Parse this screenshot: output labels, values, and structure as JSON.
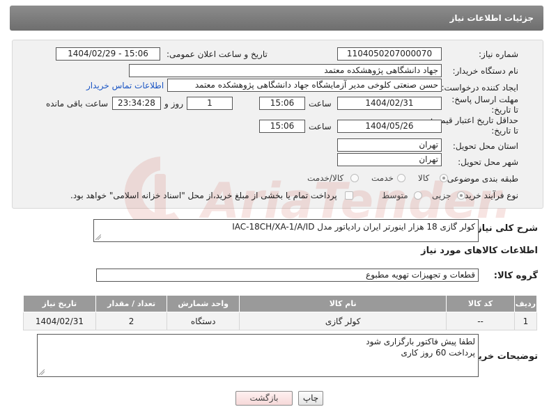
{
  "header": {
    "title": "جزئیات اطلاعات نیاز"
  },
  "form": {
    "need_number_label": "شماره نیاز:",
    "need_number": "1104050207000070",
    "announce_label": "تاریخ و ساعت اعلان عمومی:",
    "announce_value": "1404/02/29 - 15:06",
    "buyer_org_label": "نام دستگاه خریدار:",
    "buyer_org": "جهاد دانشگاهی پژوهشکده معتمد",
    "creator_label": "ایجاد کننده درخواست:",
    "creator": "حسن صنعتی کلوخی مدیر آزمایشگاه جهاد دانشگاهی پژوهشکده معتمد",
    "contact_link": "اطلاعات تماس خریدار",
    "deadline_label": "مهلت ارسال پاسخ: تا تاریخ:",
    "deadline_date": "1404/02/31",
    "time_label": "ساعت",
    "deadline_time": "15:06",
    "days_value": "1",
    "days_label": "روز و",
    "remaining_time": "23:34:28",
    "remaining_label": "ساعت باقی مانده",
    "validity_label": "حداقل تاریخ اعتبار قیمت: تا تاریخ:",
    "validity_date": "1404/05/26",
    "validity_time": "15:06",
    "province_label": "استان محل تحویل:",
    "province": "تهران",
    "city_label": "شهر محل تحویل:",
    "city": "تهران",
    "category_label": "طبقه بندی موضوعی:",
    "category_options": [
      "کالا",
      "خدمت",
      "کالا/خدمت"
    ],
    "process_label": "نوع فرآیند خرید :",
    "process_options": [
      "جزیی",
      "متوسط"
    ],
    "payment_note": "پرداخت تمام یا بخشی از مبلغ خرید،از محل \"اسناد خزانه اسلامی\" خواهد بود."
  },
  "description": {
    "label": "شرح کلی نیاز:",
    "value": "کولر گازی 18 هزار اینورتر ایران رادیاتور مدل IAC-18CH/XA-1/A/ID"
  },
  "goods_info": {
    "heading": "اطلاعات کالاهای مورد نیاز",
    "group_label": "گروه کالا:",
    "group_value": "قطعات و تجهیزات تهویه مطبوع"
  },
  "table": {
    "headers": [
      "ردیف",
      "کد کالا",
      "نام کالا",
      "واحد شمارش",
      "تعداد / مقدار",
      "تاریخ نیاز"
    ],
    "rows": [
      [
        "1",
        "--",
        "کولر گازی",
        "دستگاه",
        "2",
        "1404/02/31"
      ]
    ]
  },
  "buyer_notes": {
    "label": "توضیحات خریدار:",
    "line1": "لطفا پیش فاکتور بارگزاری شود",
    "line2": "پرداخت 60 روز کاری"
  },
  "buttons": {
    "print": "چاپ",
    "back": "بازگشت"
  },
  "watermark": {
    "text": "AriaTender.net"
  }
}
